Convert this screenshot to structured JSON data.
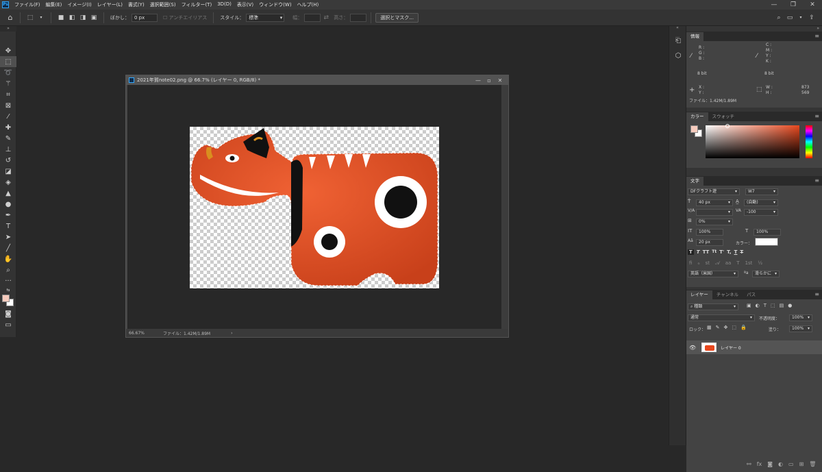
{
  "app": {
    "logo": "Ps"
  },
  "menu": [
    "ファイル(F)",
    "編集(E)",
    "イメージ(I)",
    "レイヤー(L)",
    "書式(Y)",
    "選択範囲(S)",
    "フィルター(T)",
    "3D(D)",
    "表示(V)",
    "ウィンドウ(W)",
    "ヘルプ(H)"
  ],
  "options": {
    "feather_label": "ぼかし：",
    "feather_value": "0 px",
    "antialias_label": "アンチエイリアス",
    "style_label": "スタイル：",
    "style_value": "標準",
    "width_label": "幅：",
    "height_label": "高さ：",
    "select_mask_button": "選択とマスク..."
  },
  "document": {
    "title": "2021年賀note02.png @ 66.7% (レイヤー 0, RGB/8) *",
    "zoom": "66.67%",
    "file_info": "ファイル：1.42M/1.89M"
  },
  "info_panel": {
    "tab": "情報",
    "rgb": [
      "R :",
      "G :",
      "B :"
    ],
    "cmyk": [
      "C :",
      "M :",
      "Y :",
      "K :"
    ],
    "bit_left": "8 bit",
    "bit_right": "8 bit",
    "xy": [
      "X :",
      "Y :"
    ],
    "wh": [
      "W :",
      "H :"
    ],
    "w_value": "873",
    "h_value": "569",
    "file_info": "ファイル：1.42M/1.89M"
  },
  "color_panel": {
    "tabs": [
      "カラー",
      "スウォッチ"
    ],
    "foreground": "#f6cbbd",
    "background": "#ffffff"
  },
  "character_panel": {
    "tab": "文字",
    "font_family": "DFクラフト遊",
    "font_weight": "W7",
    "font_size": "40 px",
    "leading": "(自動)",
    "kerning": "V/A",
    "tracking": "-100",
    "tsume": "0%",
    "vscale": "100%",
    "hscale": "100%",
    "baseline": "20 px",
    "color_label": "カラー：",
    "language": "英語（米国）",
    "antialias": "滑らかに"
  },
  "layers_panel": {
    "tabs": [
      "レイヤー",
      "チャンネル",
      "パス"
    ],
    "filter_kind": "種類",
    "blend_mode": "通常",
    "opacity_label": "不透明度：",
    "opacity": "100%",
    "lock_label": "ロック：",
    "fill_label": "塗り：",
    "fill": "100%",
    "layers": [
      {
        "name": "レイヤー 0"
      }
    ]
  }
}
